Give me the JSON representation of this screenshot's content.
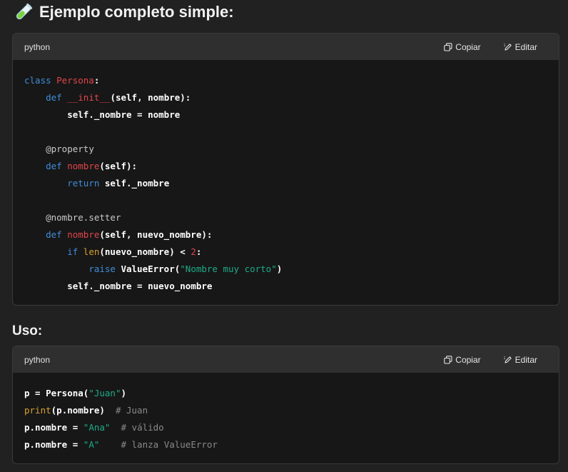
{
  "heading_main": "Ejemplo completo simple:",
  "heading_uso": "Uso:",
  "blocks": [
    {
      "language": "python",
      "copy_label": "Copiar",
      "edit_label": "Editar",
      "lines": [
        [
          [
            "kw",
            "class "
          ],
          [
            "cls",
            "Persona"
          ],
          [
            "txt",
            ":"
          ]
        ],
        [
          [
            "txt",
            "    "
          ],
          [
            "kw",
            "def "
          ],
          [
            "fn",
            "__init__"
          ],
          [
            "txt",
            "(self, nombre):"
          ]
        ],
        [
          [
            "txt",
            "        self._nombre = nombre"
          ]
        ],
        [
          [
            "txt",
            ""
          ]
        ],
        [
          [
            "txt",
            "    "
          ],
          [
            "dec",
            "@property"
          ]
        ],
        [
          [
            "txt",
            "    "
          ],
          [
            "kw",
            "def "
          ],
          [
            "fn",
            "nombre"
          ],
          [
            "txt",
            "(self):"
          ]
        ],
        [
          [
            "txt",
            "        "
          ],
          [
            "kw",
            "return "
          ],
          [
            "txt",
            "self._nombre"
          ]
        ],
        [
          [
            "txt",
            ""
          ]
        ],
        [
          [
            "txt",
            "    "
          ],
          [
            "dec",
            "@nombre.setter"
          ]
        ],
        [
          [
            "txt",
            "    "
          ],
          [
            "kw",
            "def "
          ],
          [
            "fn",
            "nombre"
          ],
          [
            "txt",
            "(self, nuevo_nombre):"
          ]
        ],
        [
          [
            "txt",
            "        "
          ],
          [
            "kw",
            "if "
          ],
          [
            "bi",
            "len"
          ],
          [
            "txt",
            "(nuevo_nombre) < "
          ],
          [
            "num",
            "2"
          ],
          [
            "txt",
            ":"
          ]
        ],
        [
          [
            "txt",
            "            "
          ],
          [
            "kw",
            "raise "
          ],
          [
            "txt",
            "ValueError("
          ],
          [
            "str",
            "\"Nombre muy corto\""
          ],
          [
            "txt",
            ")"
          ]
        ],
        [
          [
            "txt",
            "        self._nombre = nuevo_nombre"
          ]
        ]
      ]
    },
    {
      "language": "python",
      "copy_label": "Copiar",
      "edit_label": "Editar",
      "lines": [
        [
          [
            "txt",
            "p = Persona("
          ],
          [
            "str",
            "\"Juan\""
          ],
          [
            "txt",
            ")"
          ]
        ],
        [
          [
            "bi",
            "print"
          ],
          [
            "txt",
            "(p.nombre)  "
          ],
          [
            "com",
            "# Juan"
          ]
        ],
        [
          [
            "txt",
            "p.nombre = "
          ],
          [
            "str",
            "\"Ana\""
          ],
          [
            "txt",
            "  "
          ],
          [
            "com",
            "# válido"
          ]
        ],
        [
          [
            "txt",
            "p.nombre = "
          ],
          [
            "str",
            "\"A\""
          ],
          [
            "txt",
            "    "
          ],
          [
            "com",
            "# lanza ValueError"
          ]
        ]
      ]
    }
  ]
}
